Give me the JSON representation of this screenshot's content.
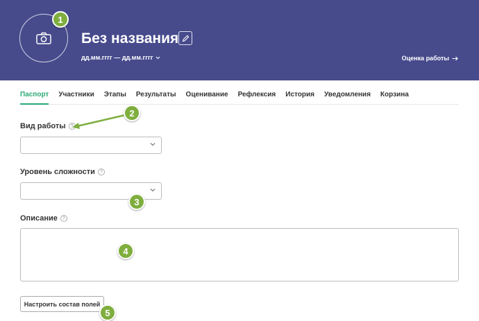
{
  "header": {
    "title": "Без названия",
    "date_range": "дд.мм.гггг — дд.мм.гггг",
    "assess_link": "Оценка работы",
    "bg_color": "#474b8c"
  },
  "tabs": [
    {
      "label": "Паспорт",
      "active": true
    },
    {
      "label": "Участники"
    },
    {
      "label": "Этапы"
    },
    {
      "label": "Результаты"
    },
    {
      "label": "Оценивание"
    },
    {
      "label": "Рефлексия"
    },
    {
      "label": "История"
    },
    {
      "label": "Уведомления"
    },
    {
      "label": "Корзина"
    }
  ],
  "form": {
    "work_type_label": "Вид работы",
    "difficulty_label": "Уровень сложности",
    "description_label": "Описание",
    "help_glyph": "?",
    "configure_button": "Настроить состав полей"
  },
  "annotations": [
    "1",
    "2",
    "3",
    "4",
    "5"
  ],
  "colors": {
    "accent": "#2aa876",
    "badge": "#7fae3f"
  },
  "icons": {
    "avatar": "camera-icon",
    "edit": "pencil-icon",
    "dates": "chevron-down-icon",
    "assess": "arrow-right-icon",
    "select": "chevron-down-icon",
    "help": "question-circle-icon"
  }
}
